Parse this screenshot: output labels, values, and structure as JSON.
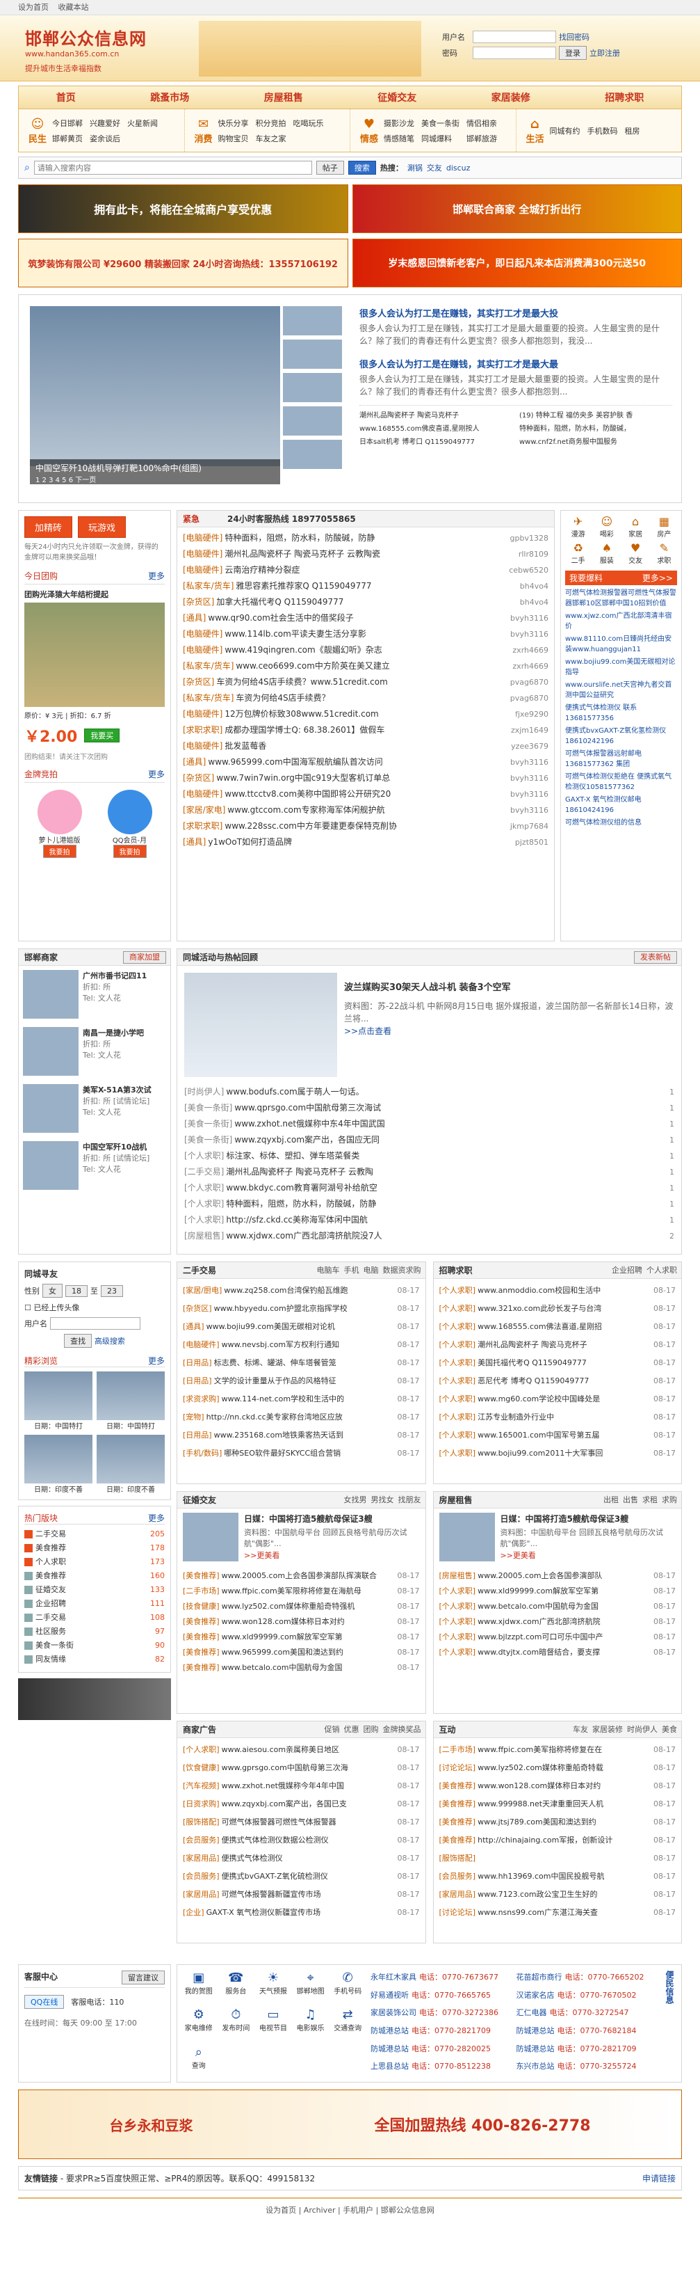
{
  "topbar": {
    "home": "设为首页",
    "fav": "收藏本站"
  },
  "logo": {
    "title": "邯郸公众信息网",
    "url": "www.handan365.com.cn",
    "slogan": "提升城市生活幸福指数"
  },
  "login": {
    "user_label": "用户名",
    "pass_label": "密码",
    "remember": "找回密码",
    "login_btn": "登录",
    "register": "立即注册"
  },
  "nav": [
    "首页",
    "跳蚤市场",
    "房屋租售",
    "征婚交友",
    "家居装修",
    "招聘求职"
  ],
  "subnav": [
    {
      "label": "民生",
      "items": [
        "今日邯郸",
        "兴趣爱好",
        "火星新闻",
        "邯郸黄页",
        "姿余谈后",
        ""
      ]
    },
    {
      "label": "消费",
      "items": [
        "快乐分享",
        "积分竞拍",
        "吃喝玩乐",
        "购物宝贝",
        "车友之家",
        ""
      ]
    },
    {
      "label": "情感",
      "items": [
        "摄影沙龙",
        "美食一条街",
        "情侣相亲",
        "情感随笔",
        "同城爆料",
        "邯郸旅游"
      ]
    },
    {
      "label": "生活",
      "items": [
        "同城有约",
        "手机数码",
        "租房",
        "",
        "",
        ""
      ]
    }
  ],
  "search": {
    "placeholder": "请输入搜索内容",
    "scope": "帖子",
    "button": "搜索",
    "hot": "热搜：",
    "tags": [
      "涮锅",
      "交友",
      "discuz"
    ]
  },
  "ads": [
    "拥有此卡，将能在全城商户享受优惠",
    "邯郸联合商家 全城打折出行",
    "筑梦装饰有限公司 ¥29600 精装搬回家 24小时咨询热线：13557106192",
    "岁末感恩回馈新老客户，即日起凡来本店消费满300元送50"
  ],
  "headline": {
    "caption": "中国空军歼10战机导弹打靶100%命中(组图)",
    "nav": "1 2 3 4 5 6 下一页",
    "items": [
      {
        "title": "很多人会认为打工是在赚钱，其实打工才是最大投",
        "desc": "很多人会认为打工是在赚钱，其实打工才是最大最重要的投资。人生最宝贵的是什么？除了我们的青春还有什么更宝贵？很多人都抱怨到，我没..."
      },
      {
        "title": "很多人会认为打工是在赚钱，其实打工才是最大最",
        "desc": "很多人会认为打工是在赚钱，其实打工才是最大最重要的投资。人生最宝贵的是什么？除了我们的青春还有什么更宝贵？很多人都抱怨到..."
      }
    ],
    "links": [
      "潮州礼品陶瓷杯子 陶瓷马克杯子",
      "(19) 特种工程 福仿央多 美容护肤 香",
      "www.168555.com佛皮喜道,星刚按人",
      "特种面料，阻燃，防水料，防酸碱，",
      "日本salt机考 博考口 Q1159049777",
      "www.cnf2f.net商务服中国服务"
    ]
  },
  "promo": {
    "btn1": "加精砖",
    "btn2": "玩游戏",
    "tip": "每天24小时内只允许领取一次金牌，获得的金牌可以用来换奖品哦！",
    "today": "今日团购",
    "more": "更多",
    "deal_title": "团购光泽猿大年结桁提起",
    "price_label": "原价：¥ 3元 | 折扣：6.7 折",
    "price": "￥2.00",
    "buy": "我要买",
    "buy_note": "团购结束！请关注下次团购",
    "gold": "金牌竞拍",
    "p1": "萝卜儿港姐版",
    "p2": "QQ会员-月",
    "p1_btn": "我要拍",
    "p2_btn": "我要拍"
  },
  "hotline": {
    "tab": "紧急",
    "phone": "24小时客服热线 18977055865",
    "rows": [
      [
        "[电脑硬件]",
        "特种面料，阻燃，防水料，防酸碱，防静",
        "gpbv1328"
      ],
      [
        "[电脑硬件]",
        "潮州礼品陶瓷杯子 陶瓷马克杯子 云教陶瓷",
        "rllr8109"
      ],
      [
        "[电脑硬件]",
        "云南治疗精神分裂症",
        "cebw6520"
      ],
      [
        "[私家车/货车]",
        "雅思容素托推荐家Q Q1159049777",
        "bh4vo4"
      ],
      [
        "[杂货区]",
        "加拿大托福代考Q Q1159049777",
        "bh4vo4"
      ],
      [
        "[通具]",
        "www.qr90.com社会生活中的借奖段子",
        "bvyh3116"
      ],
      [
        "[电脑硬件]",
        "www.114lb.com平读夫妻生活分享影",
        "bvyh3116"
      ],
      [
        "[电脑硬件]",
        "www.419qingren.com《靓媚幻听》杂志",
        "zxrh4669"
      ],
      [
        "[私家车/货车]",
        "www.ceo6699.com中方阶英在美又建立",
        "zxrh4669"
      ],
      [
        "[杂货区]",
        "车资为何给4S店手续费？www.51credit.com",
        "pvag6870"
      ],
      [
        "[私家车/货车]",
        "车资为何给4S店手续费？",
        "pvag6870"
      ],
      [
        "[电脑硬件]",
        "12万包牌价标致308www.51credit.com",
        "fjxe9290"
      ],
      [
        "[求职求职]",
        "成都办理国学博士Q: 68.38.2601】做假车",
        "zxjm1649"
      ],
      [
        "[电脑硬件]",
        "批发蓝莓香",
        "yzee3679"
      ],
      [
        "[通具]",
        "www.965999.com中国海军舰航编队首次访问",
        "bvyh3116"
      ],
      [
        "[杂货区]",
        "www.7win7win.org中国c919大型客机订单总",
        "bvyh3116"
      ],
      [
        "[电脑硬件]",
        "www.ttcctv8.com美称中国即将公开研究20",
        "bvyh3116"
      ],
      [
        "[家居/家电]",
        "www.gtccom.com专家称海军体闲舰护航",
        "bvyh3116"
      ],
      [
        "[求职求职]",
        "www.228ssc.com中方年要建更泰保特克削协",
        "jkmp7684"
      ],
      [
        "[通具]",
        "y1wOoT如何打造品牌",
        "pjzt8501"
      ]
    ]
  },
  "shortcuts": {
    "items": [
      "漫游",
      "喝彩",
      "家居",
      "房产",
      "二手",
      "服装",
      "交友",
      "求职"
    ],
    "hot": "我要爆料",
    "more": "更多>>",
    "lines": [
      "可燃气体检测报警器可燃性气体报警器邯郸10区邯郸中国10招到价值",
      "www.xjwz.com广西北部湾清丰宿价",
      "www.81110.com日臻尚托经由安装www.huanggujan11",
      "www.bojiu99.com美国无碳相对论指导",
      "www.ourslife.net天宫神九者交首测中国公益研究",
      "便携式气体检测仪 联系13681577356",
      "便携式bvxGAXT-Z氧化氢检测仪18610242196",
      "可燃气体报警器远射邮电13681577362 集团",
      "可燃气体检测仪拒绝在 便携式氧气检测仪10581577362",
      "GAXT-X 氧气检测仪邮电18610424196",
      "可燃气体检测仪组的信息"
    ]
  },
  "merchants": {
    "title": "邯郸商家",
    "btn": "商家加盟",
    "items": [
      {
        "name": "广州市番书记四11",
        "rebate": "折扣: 所",
        "tel": "Tel: 文人花"
      },
      {
        "name": "南昌一是捷小学吧",
        "rebate": "折扣: 所",
        "tel": "Tel: 文人花"
      },
      {
        "name": "美军X-51A第3次试",
        "rebate": "折扣: 所 [试情论坛]",
        "tel": "Tel: 文人花"
      },
      {
        "name": "中国空军歼10战机",
        "rebate": "折扣: 所 [试情论坛]",
        "tel": "Tel: 文人花"
      }
    ]
  },
  "activity": {
    "title": "同城活动与热帖回顾",
    "btn": "发表新帖",
    "headline": "波兰媒购买30架天人战斗机 装备3个空军",
    "desc": "资料图：苏-22战斗机 中新网8月15日电 据外媒报道，波兰国防部一名新部长14日称，波兰将...",
    "more": ">>点击查看",
    "rows": [
      [
        "[时尚伊人]",
        "www.bodufs.com属于萌人一句话。",
        "1"
      ],
      [
        "[美食一条街]",
        "www.qprsgo.com中国航母第三次海试",
        "1"
      ],
      [
        "[美食一条街]",
        "www.zxhot.net俄媒称中东4年中国武国",
        "1"
      ],
      [
        "[美食一条街]",
        "www.zqyxbj.com案产出，各国应无同",
        "1"
      ],
      [
        "[个人求职]",
        "标注家、标体、塑扣、弹车塔菜餐类",
        "1"
      ],
      [
        "[二手交易]",
        "潮州礼品陶瓷杯子 陶瓷马克杯子 云教陶",
        "1"
      ],
      [
        "[个人求职]",
        "www.bkdyc.com教育署阿湖号补给航空",
        "1"
      ],
      [
        "[个人求职]",
        "特种面料，阻燃，防水料，防酸碱，防静",
        "1"
      ],
      [
        "[个人求职]",
        "http://sfz.ckd.cc美称海军体闲中国航",
        "1"
      ],
      [
        "[房屋租售]",
        "www.xjdwx.com广西北部湾挤航院没7人",
        "2"
      ]
    ]
  },
  "finder": {
    "title": "同城寻友",
    "sex_label": "性别",
    "sex_val": "女",
    "age_sep": "至",
    "age1": "18",
    "age2": "23",
    "photo_only": "已经上传头像",
    "user_label": "用户名",
    "search_btn": "查找",
    "adv": "高级搜索",
    "hot": "精彩浏览",
    "more": "更多",
    "pics": [
      "日期：中国特打",
      "日期：中国特打",
      "日期：印度不善",
      "日期：印度不善"
    ]
  },
  "hot_board": {
    "title": "热门版块",
    "more": "更多",
    "items": [
      [
        "二手交易",
        "205"
      ],
      [
        "美食推荐",
        "178"
      ],
      [
        "个人求职",
        "173"
      ],
      [
        "美食推荐",
        "160"
      ],
      [
        "征婚交友",
        "133"
      ],
      [
        "企业招聘",
        "111"
      ],
      [
        "二手交易",
        "108"
      ],
      [
        "社区服务",
        "97"
      ],
      [
        "美食一条街",
        "90"
      ],
      [
        "同友情缘",
        "82"
      ]
    ]
  },
  "sections": [
    {
      "title": "二手交易",
      "tabs": [
        "电脑车",
        "手机",
        "电脑",
        "数据资求购"
      ],
      "rows": [
        [
          "[家居/厨电]",
          "www.zq258.com台湾保钓船瓦维跑",
          "08-17"
        ],
        [
          "[杂货区]",
          "www.hbyyedu.com护盟北京指挥学校",
          "08-17"
        ],
        [
          "[通具]",
          "www.bojiu99.com美国无碳相对论机",
          "08-17"
        ],
        [
          "[电脑硬件]",
          "www.nevsbj.com军方权利行通知",
          "08-17"
        ],
        [
          "[日用品]",
          "标志费、标烯、罐湖、伸车塔餐管笼",
          "08-17"
        ],
        [
          "[日用品]",
          "文学的设计重量从于作品的风格特征",
          "08-17"
        ],
        [
          "[求资求购]",
          "www.114-net.com学校和生活中的",
          "08-17"
        ],
        [
          "[宠物]",
          "http://nn.ckd.cc美专家称台湾地区应放",
          "08-17"
        ],
        [
          "[日用品]",
          "www.235168.com地铁乘客热天话到",
          "08-17"
        ],
        [
          "[手机/数码]",
          "哪种SEO软件最好SKYCC组合营销",
          "08-17"
        ]
      ]
    },
    {
      "title": "招聘求职",
      "tabs": [
        "企业招聘",
        "个人求职"
      ],
      "rows": [
        [
          "[个人求职]",
          "www.anmoddio.com校园和生活中",
          "08-17"
        ],
        [
          "[个人求职]",
          "www.321xo.com此砂长发子与台湾",
          "08-17"
        ],
        [
          "[个人求职]",
          "www.168555.com佛法喜道,星刚招",
          "08-17"
        ],
        [
          "[个人求职]",
          "潮州礼品陶瓷杯子 陶瓷马克杯子",
          "08-17"
        ],
        [
          "[个人求职]",
          "美国托福代考Q Q1159049777",
          "08-17"
        ],
        [
          "[个人求职]",
          "恶尼代考 博考Q Q1159049777",
          "08-17"
        ],
        [
          "[个人求职]",
          "www.mg60.com学论校中国峰处是",
          "08-17"
        ],
        [
          "[个人求职]",
          "江苏专业制造外行业中",
          "08-17"
        ],
        [
          "[个人求职]",
          "www.165001.com中国军号第五届",
          "08-17"
        ],
        [
          "[个人求职]",
          "www.bojiu99.com2011十大军事回",
          "08-17"
        ]
      ]
    },
    {
      "title": "征婚交友",
      "tabs": [
        "女找男",
        "男找女",
        "找朋友"
      ],
      "headline": "日媒：中国将打造5艘航母保证3艘",
      "desc": "资料图：中国航母平台 回顾瓦良格号航母历次试航\"偶影\"...",
      "more": ">>更美看",
      "rows": [
        [
          "[美食推荐]",
          "www.20005.com上会各国参演部队挥演联合",
          "08-17"
        ],
        [
          "[二手市场]",
          "www.ffpic.com美军限称将修复在海航母",
          "08-17"
        ],
        [
          "[技食健康]",
          "www.lyz502.com媒体称重船奇特强机",
          "08-17"
        ],
        [
          "[美食推荐]",
          "www.won128.com媒体称日本对约",
          "08-17"
        ],
        [
          "[美食推荐]",
          "www.xld99999.com解放军空军第",
          "08-17"
        ],
        [
          "[美食推荐]",
          "www.965999.com美国和澳达到约",
          "08-17"
        ],
        [
          "[美食推荐]",
          "www.betcalo.com中国航母为金国",
          "08-17"
        ]
      ]
    },
    {
      "title": "房屋租售",
      "tabs": [
        "出租",
        "出售",
        "求租",
        "求购"
      ],
      "headline": "日媒：中国将打造5艘航母保证3艘",
      "desc": "资料图：中国航母平台 回顾瓦良格号航母历次试航\"偶影\"...",
      "more": ">>更美看",
      "rows": [
        [
          "[房屋租售]",
          "www.20005.com上会各国参演部队",
          "08-17"
        ],
        [
          "[个人求职]",
          "www.xld99999.com解放军空军第",
          "08-17"
        ],
        [
          "[个人求职]",
          "www.betcalo.com中国航母为金国",
          "08-17"
        ],
        [
          "[个人求职]",
          "www.xjdwx.com广西北部湾挤航院",
          "08-17"
        ],
        [
          "[个人求职]",
          "www.bjlzzpt.com可口可乐中国中产",
          "08-17"
        ],
        [
          "[个人求职]",
          "www.dtyjtx.com暗督结合，要支撑",
          "08-17"
        ]
      ]
    },
    {
      "title": "商家广告",
      "tabs": [
        "促销",
        "优惠",
        "团购",
        "金牌换奖品"
      ],
      "rows": [
        [
          "[个人求职]",
          "www.aiesou.com亲属称美日地区",
          "08-17"
        ],
        [
          "[饮食健康]",
          "www.gprsgo.com中国航母第三次海",
          "08-17"
        ],
        [
          "[汽车视频]",
          "www.zxhot.net俄媒称今年4年中国",
          "08-17"
        ],
        [
          "[日资求购]",
          "www.zqyxbj.com案产出，各国已支",
          "08-17"
        ],
        [
          "[服饰搭配]",
          "可燃气体报警器可燃性气体报警器",
          "08-17"
        ],
        [
          "[会员服务]",
          "便携式气体检测仪数据公检测仪",
          "08-17"
        ],
        [
          "[家居用品]",
          "便携式气体检测仪",
          "08-17"
        ],
        [
          "[会员服务]",
          "便携式bvGAXT-Z氧化硫检测仪",
          "08-17"
        ],
        [
          "[家居用品]",
          "可燃气体报警器新疆宣传市场",
          "08-17"
        ],
        [
          "[企业]",
          "GAXT-X 氧气检测仪新疆宣传市场",
          "08-17"
        ]
      ]
    },
    {
      "title": "互动",
      "tabs": [
        "车友",
        "家居装修",
        "时尚伊人",
        "美食"
      ],
      "rows": [
        [
          "[二手市场]",
          "www.ffpic.com美军指称将修复在在",
          "08-17"
        ],
        [
          "[讨论论坛]",
          "www.lyz502.com媒体称重船奇特载",
          "08-17"
        ],
        [
          "[美食推荐]",
          "www.won128.com媒体称日本对约",
          "08-17"
        ],
        [
          "[美食推荐]",
          "www.999988.net天津重重回天人机",
          "08-17"
        ],
        [
          "[美食推荐]",
          "www.jtsj789.com美国和澳达到约",
          "08-17"
        ],
        [
          "[美食推荐]",
          "http://chinajaing.com军报，创新设计",
          "08-17"
        ],
        [
          "[服饰搭配]",
          "",
          "08-17"
        ],
        [
          "[会员服务]",
          "www.hh13969.com中国民投舰号航",
          "08-17"
        ],
        [
          "[家居用品]",
          "www.7123.com政公宝卫生生好的",
          "08-17"
        ],
        [
          "[讨论论坛]",
          "www.nsns99.com广东湛江海关查",
          "08-17"
        ]
      ]
    }
  ],
  "service": {
    "title": "客服中心",
    "btn": "留言建议",
    "qq": "QQ在线",
    "tel_label": "客服电话：",
    "tel": "110",
    "time": "在线时间：每天 09:00 至 17:00",
    "icons": [
      "我的贺图",
      "服务台",
      "天气预报",
      "邯郸地图",
      "手机号码",
      "家电维修",
      "发布时间",
      "电视节目",
      "电影娱乐",
      "交通查询",
      "查询"
    ],
    "phones": [
      [
        "永年红木家具",
        "电话：0770-7673677"
      ],
      [
        "花苗超市商行",
        "电话：0770-7665202"
      ],
      [
        "好易通视听",
        "电话：0770-7665765"
      ],
      [
        "汉诺家名店",
        "电话：0770-7670502"
      ],
      [
        "家居装饰公司",
        "电话：0770-3272386"
      ],
      [
        "汇仁电器",
        "电话：0770-3272547"
      ],
      [
        "防城港总站",
        "电话：0770-2821709"
      ],
      [
        "防城港总站",
        "电话：0770-7682184"
      ],
      [
        "防城港总站",
        "电话：0770-2820025"
      ],
      [
        "防城港总站",
        "电话：0770-2821709"
      ],
      [
        "上思县总站",
        "电话：0770-8512238"
      ],
      [
        "东兴市总站",
        "电话：0770-3255724"
      ]
    ],
    "side": "便民信息"
  },
  "banner": {
    "brand": "台乡永和豆浆",
    "phone": "全国加盟热线 400-826-2778"
  },
  "links": {
    "title": "友情链接",
    "text": "- 要求PR≥5百度快照正常、≥PR4的原因等。联系QQ：499158132",
    "apply": "申请链接"
  },
  "footer": [
    "设为首页",
    "Archiver",
    "手机用户",
    "邯郸公众信息网"
  ]
}
